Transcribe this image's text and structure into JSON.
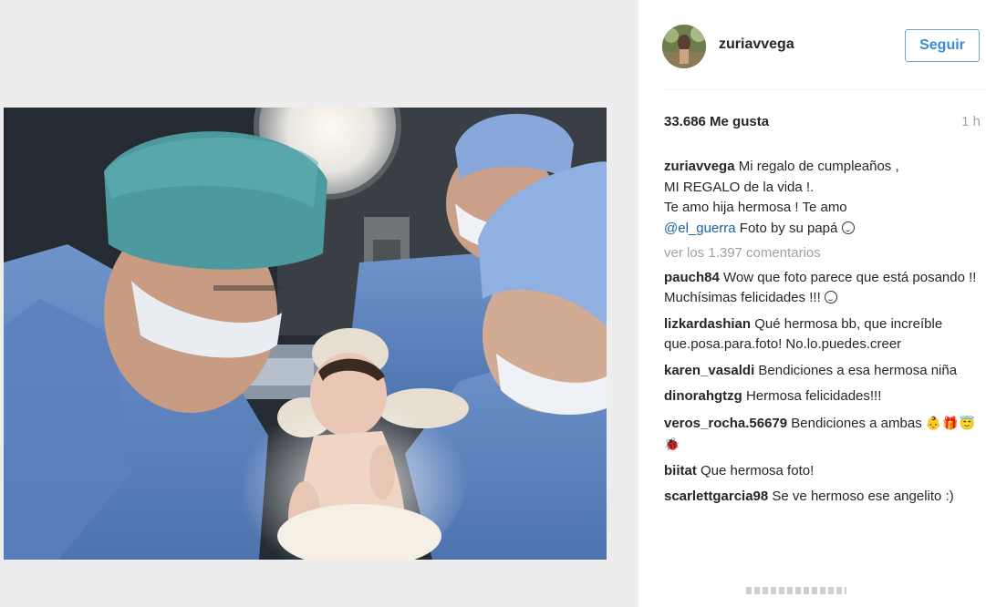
{
  "post": {
    "username": "zuriavvega",
    "follow_label": "Seguir",
    "likes": "33.686 Me gusta",
    "time": "1 h",
    "caption": {
      "user": "zuriavvega",
      "line1": " Mi regalo de cumpleaños ,",
      "line2": "MI REGALO de la vida !.",
      "line3": "Te amo hija hermosa ! Te amo",
      "mention": "@el_guerra",
      "line4_rest": " Foto by su papá"
    },
    "view_all_comments": "ver los 1.397 comentarios"
  },
  "comments": [
    {
      "user": "pauch84",
      "text": " Wow que foto parece que está posando !! Muchísimas felicidades !!!"
    },
    {
      "user": "lizkardashian",
      "text": " Qué hermosa bb, que increíble que.posa.para.foto! No.lo.puedes.creer"
    },
    {
      "user": "karen_vasaldi",
      "text": " Bendiciones a esa hermosa niña"
    },
    {
      "user": "dinorahgtzg",
      "text": " Hermosa felicidades!!!"
    },
    {
      "user": "veros_rocha.56679",
      "text": " Bendiciones a ambas",
      "emoji": "👶🎁😇🐞"
    },
    {
      "user": "biitat",
      "text": " Que hermosa foto!"
    },
    {
      "user": "scarlettgarcia98",
      "text": " Se ve hermoso ese angelito :)"
    }
  ],
  "colors": {
    "accent": "#3b8ad6",
    "mention": "#1d5fa3",
    "muted": "#a1a1a1",
    "text": "#262626"
  },
  "icons": {
    "caption_emoji": "smile-icon"
  }
}
